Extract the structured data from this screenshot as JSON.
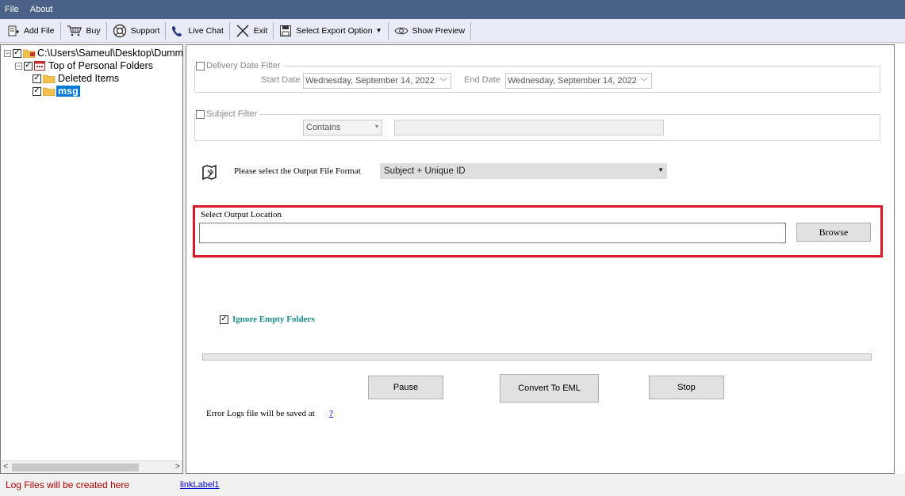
{
  "menu": {
    "items": [
      "File",
      "About"
    ]
  },
  "toolbar": {
    "add_file": "Add File",
    "buy": "Buy",
    "support": "Support",
    "live_chat": "Live Chat",
    "exit": "Exit",
    "select_export": "Select Export Option",
    "show_preview": "Show Preview"
  },
  "tree": {
    "root": "C:\\Users\\Sameul\\Desktop\\Dumm",
    "top_folder": "Top of Personal Folders",
    "deleted_items": "Deleted Items",
    "msg": "msg",
    "scroll_left": "<",
    "scroll_right": ">"
  },
  "filters": {
    "delivery_label": "Delivery Date Filter",
    "start_date_label": "Start Date",
    "start_date_value": "Wednesday, September 14, 2022",
    "end_date_label": "End Date",
    "end_date_value": "Wednesday, September 14, 2022",
    "subject_label": "Subject Filter",
    "subject_mode": "Contains",
    "subject_text": ""
  },
  "output": {
    "format_prompt": "Please select the Output File Format",
    "format_value": "Subject + Unique ID",
    "location_label": "Select Output Location",
    "location_value": "",
    "browse_label": "Browse"
  },
  "options": {
    "ignore_empty_label": "Ignore Empty Folders",
    "ignore_empty_checked": true
  },
  "progress": {
    "fraction": 0.0
  },
  "actions": {
    "pause": "Pause",
    "convert": "Convert To EML",
    "stop": "Stop"
  },
  "logs": {
    "error_logs_text": "Error Logs file will be saved at",
    "error_logs_link": "?"
  },
  "status": {
    "log_text": "Log Files will be created here",
    "link_label": "linkLabel1"
  },
  "colors": {
    "menubar": "#4a6288",
    "toolbar": "#e9ecf7",
    "highlight_border": "#d9172a",
    "selected_node": "#0078d7",
    "teal_text": "#1a8a8a",
    "status_red": "#b00000",
    "link_blue": "#0000cc"
  }
}
